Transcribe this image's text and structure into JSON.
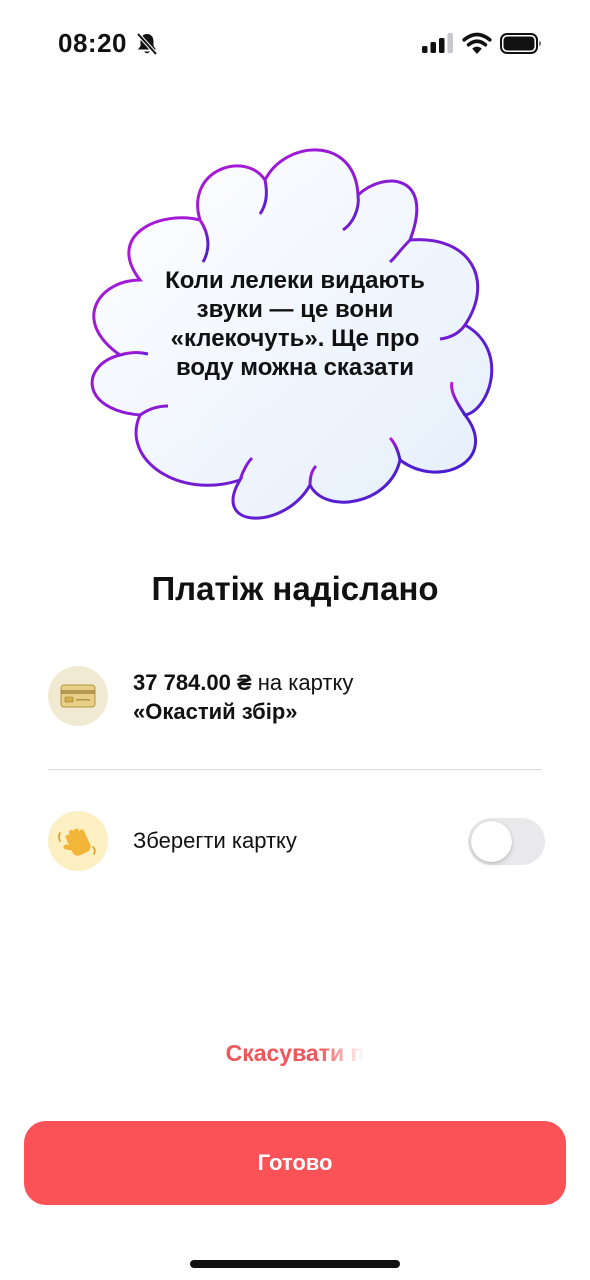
{
  "status_bar": {
    "time": "08:20",
    "icons": [
      "bell-slash-icon",
      "cellular-signal-icon",
      "wifi-icon",
      "battery-icon"
    ]
  },
  "cloud": {
    "text": "Коли лелеки видають звуки — це вони «клекочуть». Ще про воду можна сказати",
    "gradient_colors": [
      "#c018d8",
      "#3a1fcf"
    ]
  },
  "title": "Платіж надіслано",
  "payment": {
    "amount": "37 784.00 ₴",
    "suffix": " на картку",
    "recipient": "«Окастий збір»",
    "icon": "credit-card-icon"
  },
  "save_card": {
    "label": "Зберегти картку",
    "icon": "waving-hand-icon",
    "enabled": false
  },
  "cancel_link": "Скасувати п",
  "done_button": "Готово",
  "colors": {
    "accent": "#fa5256",
    "link": "#f0565a"
  }
}
